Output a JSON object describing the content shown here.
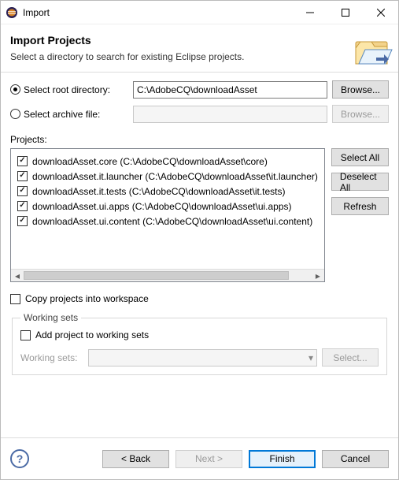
{
  "titlebar": {
    "title": "Import"
  },
  "banner": {
    "heading": "Import Projects",
    "subtext": "Select a directory to search for existing Eclipse projects."
  },
  "source": {
    "root_label": "Select root directory:",
    "root_value": "C:\\AdobeCQ\\downloadAsset",
    "archive_label": "Select archive file:",
    "archive_value": "",
    "browse_enabled": "Browse...",
    "browse_disabled": "Browse..."
  },
  "projects_label": "Projects:",
  "projects": [
    {
      "checked": true,
      "label": "downloadAsset.core (C:\\AdobeCQ\\downloadAsset\\core)"
    },
    {
      "checked": true,
      "label": "downloadAsset.it.launcher (C:\\AdobeCQ\\downloadAsset\\it.launcher)"
    },
    {
      "checked": true,
      "label": "downloadAsset.it.tests (C:\\AdobeCQ\\downloadAsset\\it.tests)"
    },
    {
      "checked": true,
      "label": "downloadAsset.ui.apps (C:\\AdobeCQ\\downloadAsset\\ui.apps)"
    },
    {
      "checked": true,
      "label": "downloadAsset.ui.content (C:\\AdobeCQ\\downloadAsset\\ui.content)"
    }
  ],
  "side": {
    "select_all": "Select All",
    "deselect_all": "Deselect All",
    "refresh": "Refresh"
  },
  "copy_label": "Copy projects into workspace",
  "workingsets": {
    "legend": "Working sets",
    "add_label": "Add project to working sets",
    "ws_label": "Working sets:",
    "select_btn": "Select..."
  },
  "footer": {
    "back": "< Back",
    "next": "Next >",
    "finish": "Finish",
    "cancel": "Cancel"
  }
}
